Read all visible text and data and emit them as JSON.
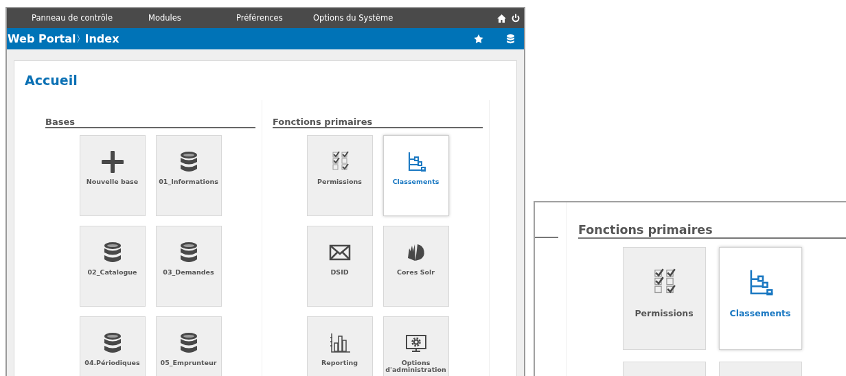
{
  "nav": {
    "items": [
      "Panneau de contrôle",
      "Modules",
      "Préférences",
      "Options du Système"
    ]
  },
  "breadcrumb": {
    "items": [
      "Web Portal",
      "Index"
    ],
    "separator": "〉"
  },
  "page": {
    "title": "Accueil",
    "sections": [
      {
        "title": "Bases",
        "tiles": [
          {
            "label": "Nouvelle base",
            "kind": "plus",
            "selected": false
          },
          {
            "label": "01_Informations",
            "kind": "database",
            "selected": false
          },
          {
            "label": "02_Catalogue",
            "kind": "database",
            "selected": false
          },
          {
            "label": "03_Demandes",
            "kind": "database",
            "selected": false
          },
          {
            "label": "04.Périodiques",
            "kind": "database",
            "selected": false
          },
          {
            "label": "05_Emprunteur",
            "kind": "database",
            "selected": false
          }
        ]
      },
      {
        "title": "Fonctions primaires",
        "tiles": [
          {
            "label": "Permissions",
            "kind": "checklist",
            "selected": false
          },
          {
            "label": "Classements",
            "kind": "hierarchy",
            "selected": true
          },
          {
            "label": "DSID",
            "kind": "envelope",
            "selected": false
          },
          {
            "label": "Cores Solr",
            "kind": "shell",
            "selected": false
          },
          {
            "label": "Reporting",
            "kind": "barchart",
            "selected": false
          },
          {
            "label": "Options d'administration",
            "kind": "monitor",
            "selected": false
          }
        ]
      }
    ]
  },
  "inset": {
    "title": "Fonctions primaires",
    "tiles": [
      {
        "label": "Permissions",
        "kind": "checklist",
        "selected": false
      },
      {
        "label": "Classements",
        "kind": "hierarchy",
        "selected": true
      }
    ]
  }
}
